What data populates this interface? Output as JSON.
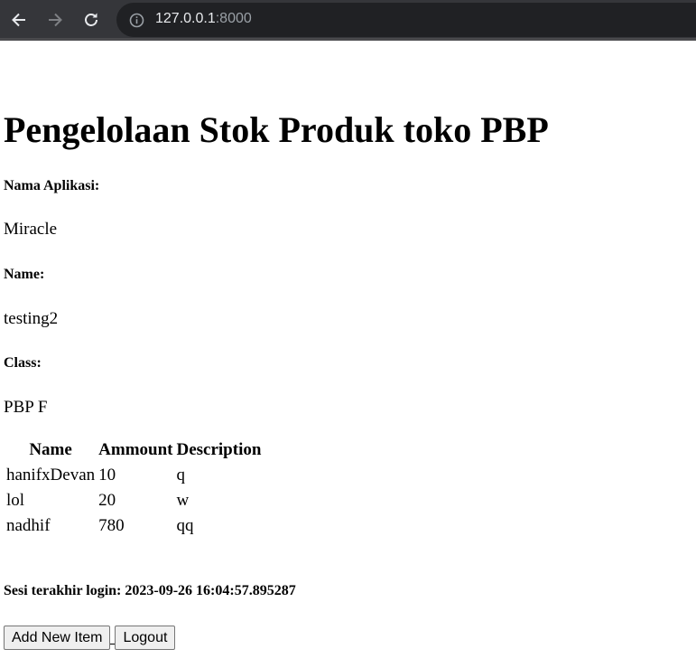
{
  "browser": {
    "url_host": "127.0.0.1",
    "url_port": ":8000"
  },
  "page": {
    "title": "Pengelolaan Stok Produk toko PBP",
    "app_name_label": "Nama Aplikasi:",
    "app_name_value": "Miracle",
    "name_label": "Name:",
    "name_value": "testing2",
    "class_label": "Class:",
    "class_value": "PBP F"
  },
  "table": {
    "headers": [
      "Name",
      "Ammount",
      "Description"
    ],
    "rows": [
      [
        "hanifxDevan",
        "10",
        "q"
      ],
      [
        "lol",
        "20",
        "w"
      ],
      [
        "nadhif",
        "780",
        "qq"
      ]
    ]
  },
  "session": {
    "text": "Sesi terakhir login: 2023-09-26 16:04:57.895287"
  },
  "actions": {
    "add_label": "Add New Item",
    "logout_label": "Logout"
  }
}
